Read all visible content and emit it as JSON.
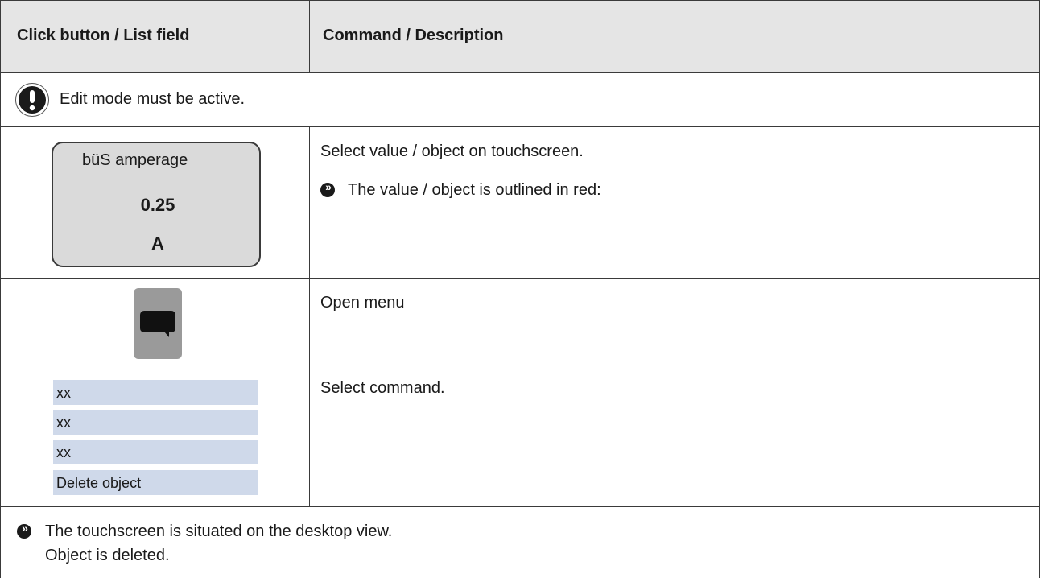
{
  "header": {
    "col1": "Click button / List field",
    "col2": "Command / Description"
  },
  "notice": {
    "icon": "exclamation-icon",
    "text": "Edit mode must be active."
  },
  "rows": [
    {
      "widget": {
        "label": "büS amperage",
        "value": "0.25",
        "unit": "A"
      },
      "description": "Select value / object on touchscreen.",
      "result": "The value / object is outlined in red:"
    },
    {
      "widget": {
        "icon": "speech-bubble-icon"
      },
      "description": "Open menu"
    },
    {
      "widget": {
        "items": [
          "xx",
          "xx",
          "xx",
          "Delete object"
        ]
      },
      "description": "Select command."
    }
  ],
  "footer": {
    "result_line1": "The touchscreen is situated on the desktop view.",
    "result_line2": "Object is deleted."
  },
  "colors": {
    "header_bg": "#e5e5e5",
    "value_box_bg": "#dadada",
    "menu_button_bg": "#9a9a9a",
    "list_item_bg": "#cfd9ea"
  }
}
